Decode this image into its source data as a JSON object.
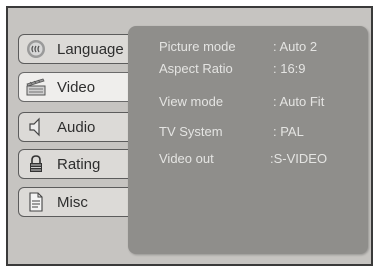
{
  "menu": {
    "items": [
      {
        "label": "Language",
        "icon": "language-icon"
      },
      {
        "label": "Video",
        "icon": "video-icon"
      },
      {
        "label": "Audio",
        "icon": "speaker-icon"
      },
      {
        "label": "Rating",
        "icon": "lock-icon"
      },
      {
        "label": "Misc",
        "icon": "document-icon"
      }
    ],
    "selected": "Video"
  },
  "settings": {
    "picture_mode": {
      "label": "Picture mode",
      "value": ": Auto 2"
    },
    "aspect_ratio": {
      "label": "Aspect Ratio",
      "value": ": 16:9"
    },
    "view_mode": {
      "label": "View mode",
      "value": ":  Auto Fit"
    },
    "tv_system": {
      "label": "TV System",
      "value": ": PAL"
    },
    "video_out": {
      "label": "Video out",
      "value": ":S-VIDEO"
    }
  }
}
